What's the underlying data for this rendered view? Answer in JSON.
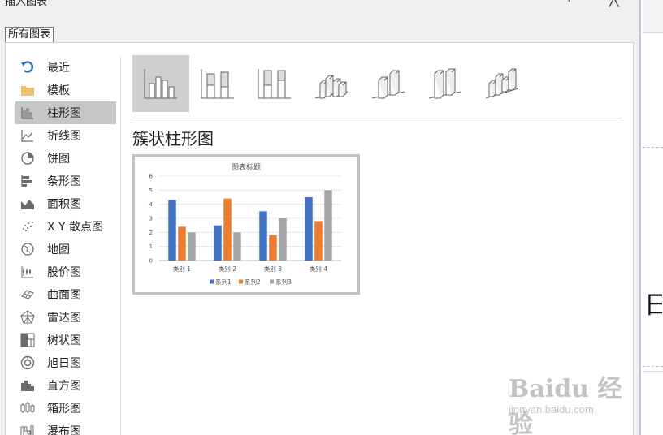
{
  "dialog": {
    "title": "插入图表",
    "help_label": "?",
    "close_label": "╳",
    "tab_label": "所有图表"
  },
  "sidebar": {
    "items": [
      {
        "label": "最近",
        "icon": "recent-icon"
      },
      {
        "label": "模板",
        "icon": "folder-icon"
      },
      {
        "label": "柱形图",
        "icon": "column-chart-icon",
        "selected": true
      },
      {
        "label": "折线图",
        "icon": "line-chart-icon"
      },
      {
        "label": "饼图",
        "icon": "pie-chart-icon"
      },
      {
        "label": "条形图",
        "icon": "bar-chart-icon"
      },
      {
        "label": "面积图",
        "icon": "area-chart-icon"
      },
      {
        "label": "X Y 散点图",
        "icon": "scatter-chart-icon"
      },
      {
        "label": "地图",
        "icon": "map-chart-icon"
      },
      {
        "label": "股价图",
        "icon": "stock-chart-icon"
      },
      {
        "label": "曲面图",
        "icon": "surface-chart-icon"
      },
      {
        "label": "雷达图",
        "icon": "radar-chart-icon"
      },
      {
        "label": "树状图",
        "icon": "treemap-chart-icon"
      },
      {
        "label": "旭日图",
        "icon": "sunburst-chart-icon"
      },
      {
        "label": "直方图",
        "icon": "histogram-chart-icon"
      },
      {
        "label": "箱形图",
        "icon": "box-whisker-chart-icon"
      },
      {
        "label": "瀑布图",
        "icon": "waterfall-chart-icon"
      }
    ]
  },
  "subtypes": [
    {
      "icon": "clustered-column-icon",
      "selected": true
    },
    {
      "icon": "stacked-column-icon"
    },
    {
      "icon": "100-stacked-column-icon"
    },
    {
      "icon": "3d-clustered-column-icon"
    },
    {
      "icon": "3d-stacked-column-icon"
    },
    {
      "icon": "3d-100-stacked-column-icon"
    },
    {
      "icon": "3d-column-icon"
    }
  ],
  "selected_chart_heading": "簇状柱形图",
  "chart_data": {
    "type": "bar",
    "title": "图表标题",
    "categories": [
      "类别 1",
      "类别 2",
      "类别 3",
      "类别 4"
    ],
    "series": [
      {
        "name": "系列1",
        "values": [
          4.3,
          2.5,
          3.5,
          4.5
        ],
        "color": "#4472c4"
      },
      {
        "name": "系列2",
        "values": [
          2.4,
          4.4,
          1.8,
          2.8
        ],
        "color": "#ed7d31"
      },
      {
        "name": "系列3",
        "values": [
          2,
          2,
          3,
          5
        ],
        "color": "#a5a5a5"
      }
    ],
    "ylim": [
      0,
      6
    ],
    "yticks": [
      "0",
      "1",
      "2",
      "3",
      "4",
      "5",
      "6"
    ],
    "grid": true,
    "legend_position": "bottom"
  },
  "side_strip": {
    "text": "日 小"
  },
  "watermark": {
    "logo": "Baidu 经验",
    "url": "jingyan.baidu.com"
  },
  "colors": {
    "selected_bg": "#c6c6c6",
    "dialog_bg": "#f0f0f0",
    "accent_purple": "#c9bfd6"
  }
}
